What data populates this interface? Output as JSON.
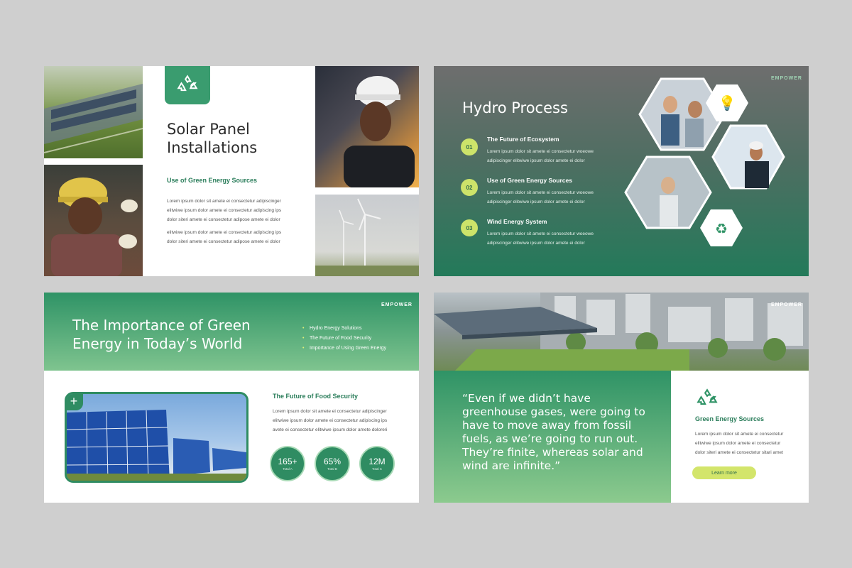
{
  "brand": "EMPOWER",
  "icons": {
    "recycle": "recycle-icon",
    "bulb": "lightbulb-icon",
    "plus": "plus-icon"
  },
  "colors": {
    "green": "#2f9366",
    "dark_green": "#2a7d5a",
    "lime": "#d3e56b",
    "light_green": "#8cca8e"
  },
  "slide1": {
    "title_line1": "Solar Panel",
    "title_line2": "Installations",
    "subtitle": "Use of Green Energy Sources",
    "para1": [
      "Lorem ipsum dolor sit amete ei consectetur adipiscinger",
      "elitwiwe ipsum dolor amete ei consectetur adipiscing ips",
      "dolor siteri amete ei consectetur adipose amete ei dolor"
    ],
    "para2": [
      "elitwiwe ipsum dolor amete ei consectetur adipiscing ips",
      "dolor siteri amete ei consectetur adipose amete ei dolor"
    ]
  },
  "slide2": {
    "title": "Hydro Process",
    "items": [
      {
        "num": "01",
        "heading": "The Future of Ecosystem",
        "lines": [
          "Lorem ipsum dolor sit amete ei consectetur woeowe",
          "adipiscinger elitwiwe ipsum dolor amete ei dolor"
        ]
      },
      {
        "num": "02",
        "heading": "Use of Green Energy Sources",
        "lines": [
          "Lorem ipsum dolor sit amete ei consectetur woeowe",
          "adipiscinger elitwiwe ipsum dolor amete ei dolor"
        ]
      },
      {
        "num": "03",
        "heading": "Wind Energy System",
        "lines": [
          "Lorem ipsum dolor sit amete ei consectetur woeowe",
          "adipiscinger elitwiwe ipsum dolor amete ei dolor"
        ]
      }
    ]
  },
  "slide3": {
    "title_line1": "The Importance of Green",
    "title_line2": "Energy in Today’s World",
    "bullets": [
      "Hydro Energy Solutions",
      "The Future of Food Security",
      "Importance of Using Green Energy"
    ],
    "subtitle": "The Future of Food Security",
    "para": [
      "Lorem ipsum dolor sit amete ei consectetur adipiscinger",
      "elitwiwe ipsum dolor amete ei consectetur adipiscing ips",
      "avete ei consectetur elitwiwe ipsum dolor amete doloreri"
    ],
    "stats": [
      {
        "value": "165+",
        "label": "Total A"
      },
      {
        "value": "65%",
        "label": "Total B"
      },
      {
        "value": "12M",
        "label": "Total C"
      }
    ]
  },
  "slide4": {
    "quote": "“Even if we didn’t  have greenhouse gases, were going to have to move away from fossil fuels, as we’re going to run out. They’re finite, whereas solar and wind are infinite.”",
    "subtitle": "Green Energy Sources",
    "para": [
      "Lorem ipsum dolor sit amete ei consectetur",
      "elitwiwe ipsum dolor amete ei consectetur",
      "dolor siteri amete ei consectetur sitari amet"
    ],
    "button": "Learn more"
  }
}
